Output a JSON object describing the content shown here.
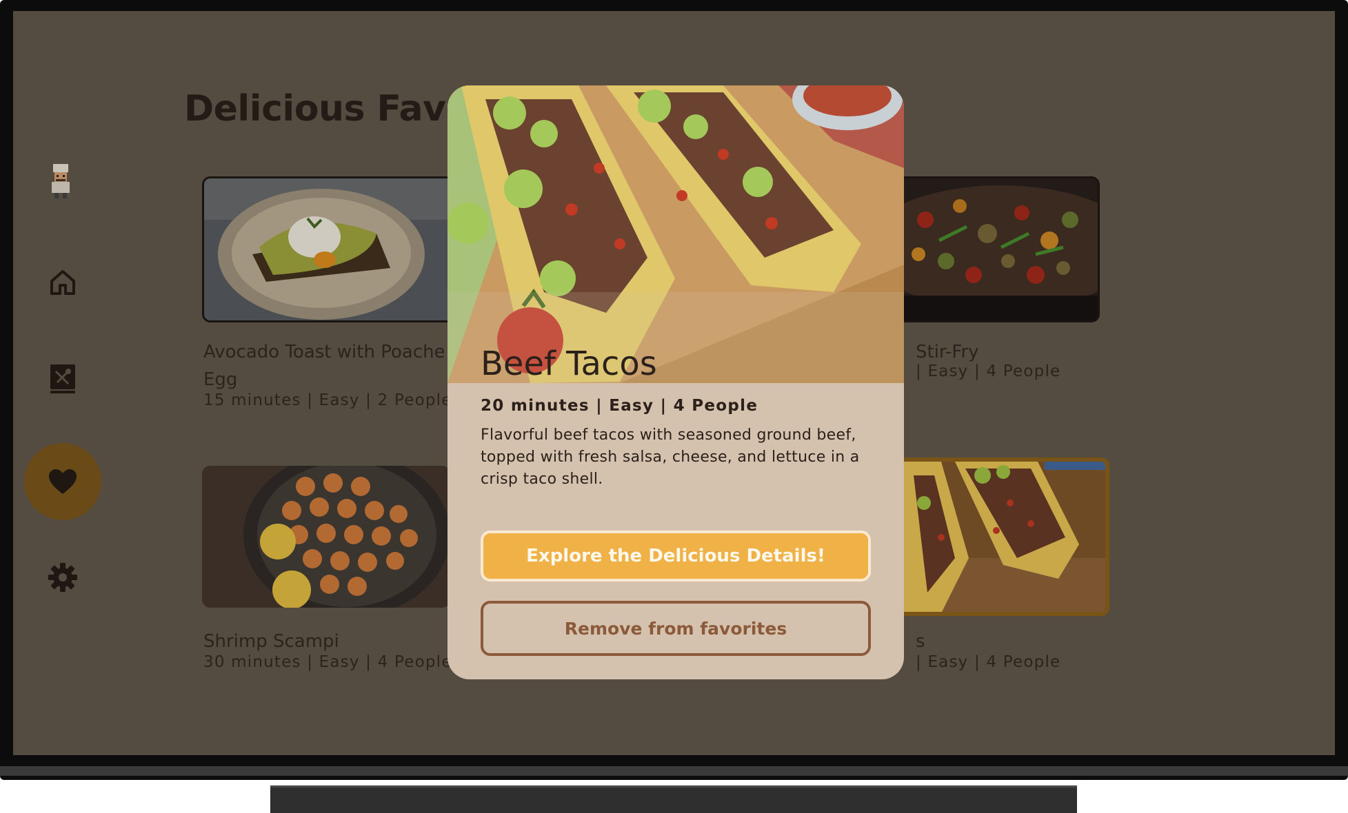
{
  "page": {
    "title": "Delicious Favor"
  },
  "nav": {
    "items": [
      {
        "name": "home",
        "icon": "home-icon"
      },
      {
        "name": "recipes",
        "icon": "recipe-book-icon"
      },
      {
        "name": "favorites",
        "icon": "heart-icon",
        "selected": true
      },
      {
        "name": "settings",
        "icon": "gear-icon"
      }
    ],
    "avatar_icon": "chef-avatar-icon"
  },
  "cards": [
    {
      "title_line1": "Avocado Toast with Poache",
      "title_line2": "Egg",
      "meta": "15 minutes | Easy | 2 People"
    },
    {
      "title_line1": "Stir-Fry",
      "meta": "| Easy | 4 People"
    },
    {
      "title_line1": "Shrimp Scampi",
      "meta": "30 minutes | Easy | 4 People"
    },
    {
      "title_line1": "s",
      "meta": "| Easy | 4 People"
    }
  ],
  "modal": {
    "title": "Beef Tacos",
    "meta": "20 minutes | Easy | 4 People",
    "description": "Flavorful beef tacos with seasoned ground beef, topped with fresh salsa, cheese, and lettuce in a crisp taco shell.",
    "primary_button": "Explore the Delicious Details!",
    "secondary_button": "Remove from favorites"
  },
  "colors": {
    "screen_bg": "#544b41",
    "accent": "#f0b247",
    "modal_bg": "#d4c2ae",
    "outline_button": "#8c5a3b",
    "selected_nav": "#6a4a16"
  }
}
